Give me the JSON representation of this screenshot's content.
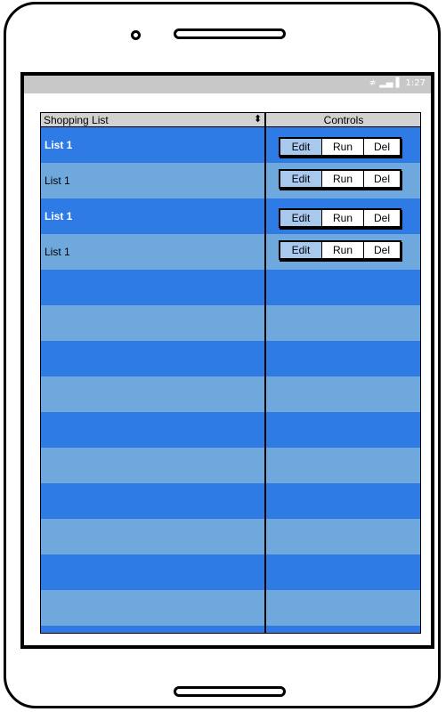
{
  "status_bar": {
    "icons": "wifi-signal-battery",
    "time": "1:27"
  },
  "table": {
    "headers": {
      "name": "Shopping List",
      "controls": "Controls"
    },
    "rows": [
      {
        "label": "List 1",
        "edit": "Edit",
        "run": "Run",
        "del": "Del"
      },
      {
        "label": "List 1",
        "edit": "Edit",
        "run": "Run",
        "del": "Del"
      },
      {
        "label": "List 1",
        "edit": "Edit",
        "run": "Run",
        "del": "Del"
      },
      {
        "label": "List 1",
        "edit": "Edit",
        "run": "Run",
        "del": "Del"
      }
    ],
    "empty_rows": 10
  },
  "colors": {
    "row_dark": "#2e7be6",
    "row_light": "#6ea8dd",
    "header": "#d2d2d2",
    "selected_button": "#a9c8ee"
  }
}
